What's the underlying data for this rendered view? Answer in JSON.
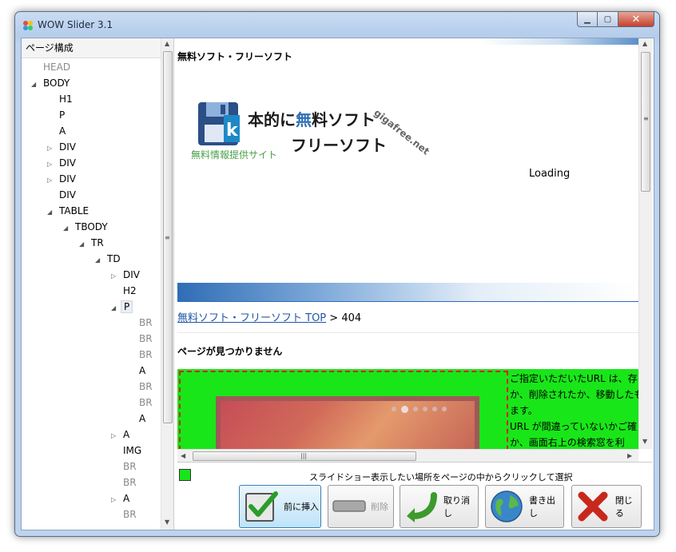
{
  "window": {
    "title": "WOW Slider 3.1"
  },
  "tree": {
    "header": "ページ構成",
    "items": [
      {
        "label": "HEAD",
        "depth": 0,
        "arrow": "none",
        "gray": true
      },
      {
        "label": "BODY",
        "depth": 0,
        "arrow": "expanded",
        "gray": false
      },
      {
        "label": "H1",
        "depth": 1,
        "arrow": "none",
        "gray": false
      },
      {
        "label": "P",
        "depth": 1,
        "arrow": "none",
        "gray": false
      },
      {
        "label": "A",
        "depth": 1,
        "arrow": "none",
        "gray": false
      },
      {
        "label": "DIV",
        "depth": 1,
        "arrow": "collapsed",
        "gray": false
      },
      {
        "label": "DIV",
        "depth": 1,
        "arrow": "collapsed",
        "gray": false
      },
      {
        "label": "DIV",
        "depth": 1,
        "arrow": "collapsed",
        "gray": false
      },
      {
        "label": "DIV",
        "depth": 1,
        "arrow": "none",
        "gray": false
      },
      {
        "label": "TABLE",
        "depth": 1,
        "arrow": "expanded",
        "gray": false
      },
      {
        "label": "TBODY",
        "depth": 2,
        "arrow": "expanded",
        "gray": false
      },
      {
        "label": "TR",
        "depth": 3,
        "arrow": "expanded",
        "gray": false
      },
      {
        "label": "TD",
        "depth": 4,
        "arrow": "expanded",
        "gray": false
      },
      {
        "label": "DIV",
        "depth": 5,
        "arrow": "collapsed",
        "gray": false
      },
      {
        "label": "H2",
        "depth": 5,
        "arrow": "none",
        "gray": false
      },
      {
        "label": "P",
        "depth": 5,
        "arrow": "expanded",
        "gray": false,
        "selected": true
      },
      {
        "label": "BR",
        "depth": 6,
        "arrow": "none",
        "gray": true
      },
      {
        "label": "BR",
        "depth": 6,
        "arrow": "none",
        "gray": true
      },
      {
        "label": "BR",
        "depth": 6,
        "arrow": "none",
        "gray": true
      },
      {
        "label": "A",
        "depth": 6,
        "arrow": "none",
        "gray": false
      },
      {
        "label": "BR",
        "depth": 6,
        "arrow": "none",
        "gray": true
      },
      {
        "label": "BR",
        "depth": 6,
        "arrow": "none",
        "gray": true
      },
      {
        "label": "A",
        "depth": 6,
        "arrow": "none",
        "gray": false
      },
      {
        "label": "A",
        "depth": 5,
        "arrow": "collapsed",
        "gray": false
      },
      {
        "label": "IMG",
        "depth": 5,
        "arrow": "none",
        "gray": false
      },
      {
        "label": "BR",
        "depth": 5,
        "arrow": "none",
        "gray": true
      },
      {
        "label": "BR",
        "depth": 5,
        "arrow": "none",
        "gray": true
      },
      {
        "label": "A",
        "depth": 5,
        "arrow": "collapsed",
        "gray": false
      },
      {
        "label": "BR",
        "depth": 5,
        "arrow": "none",
        "gray": true
      }
    ]
  },
  "page": {
    "site_title": "無料ソフト・フリーソフト",
    "logo_main_prefix": "本的に",
    "logo_main_hi": "無",
    "logo_main_suffix": "料ソフト",
    "logo_sub": "フリーソフト",
    "logo_tag": "無料情報提供サイト",
    "logo_url": "gigafree.net",
    "loading": "Loading",
    "crumb_link": "無料ソフト・フリーソフト TOP",
    "crumb_rest": " > 404",
    "heading": "ページが見つかりません",
    "green_lines": [
      "ご指定いただいたURL は、存",
      "か、削除されたか、移動したも",
      "ます。",
      "URL が間違っていないかご確",
      "か、画面右上の検索窓を利"
    ]
  },
  "bottom": {
    "hint": "スライドショー表示したい場所をページの中からクリックして選択",
    "swatch_color": "#19e619",
    "buttons": {
      "insert": "前に挿入",
      "delete": "削除",
      "undo": "取り消し",
      "export": "書き出し",
      "close": "閉じる"
    }
  }
}
